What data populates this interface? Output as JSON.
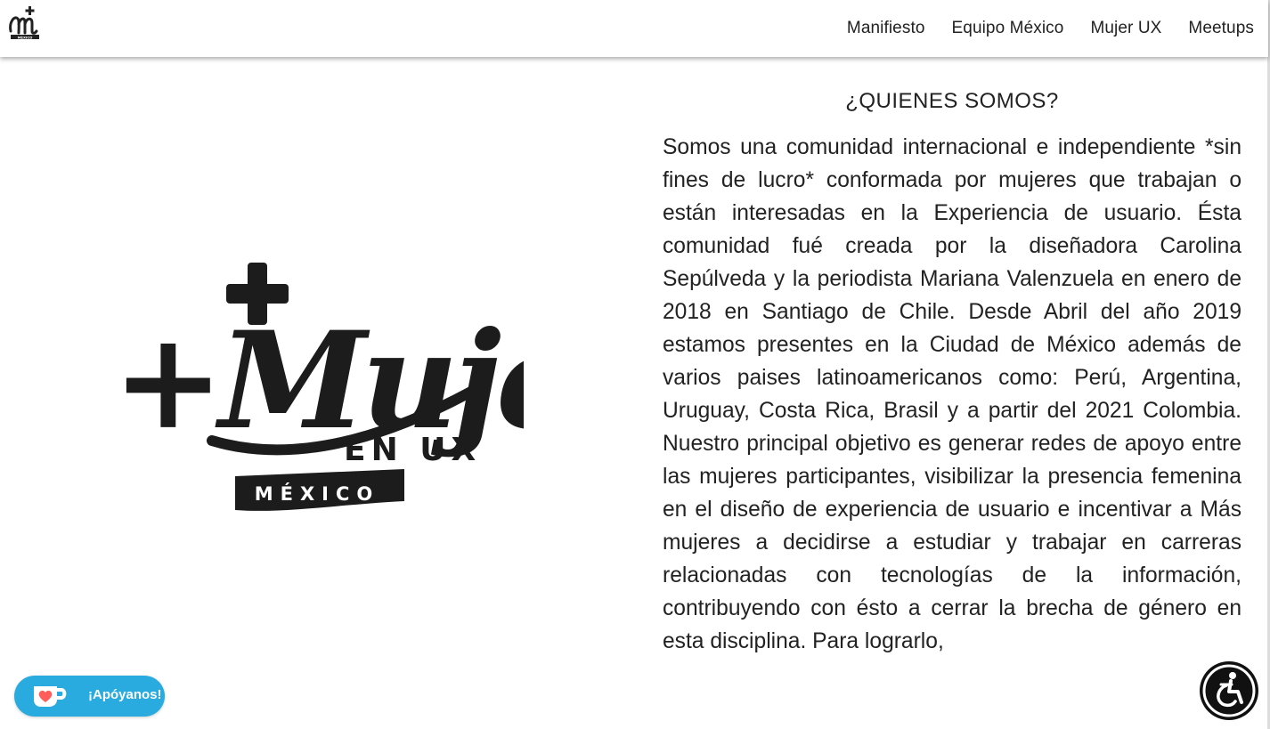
{
  "header": {
    "logo_alt": "+M México",
    "nav": [
      {
        "label": "Manifiesto"
      },
      {
        "label": "Equipo México"
      },
      {
        "label": "Mujer UX"
      },
      {
        "label": "Meetups"
      }
    ]
  },
  "hero": {
    "logo_text_main": "+Mujeres",
    "logo_text_sub": "EN UX",
    "logo_text_country": "MÉXICO"
  },
  "about": {
    "title": "¿QUIENES SOMOS?",
    "body": "Somos una comunidad internacional e independiente *sin fines de lucro* conformada por mujeres que trabajan o están interesadas en la Experiencia de usuario. Ésta comunidad fué creada por la diseñadora Carolina Sepúlveda y la periodista Mariana Valenzuela en enero de 2018 en Santiago de Chile. Desde Abril del año 2019 estamos presentes en la Ciudad de México además de varios paises latinoamericanos como: Perú, Argentina, Uruguay, Costa Rica, Brasil y a partir del 2021 Colombia. Nuestro principal objetivo es generar redes de apoyo entre las mujeres participantes, visibilizar la presencia femenina en el diseño de experiencia de usuario e incentivar a Más mujeres a decidirse a estudiar y trabajar en carreras relacionadas con tecnologías de la información, contribuyendo con ésto a cerrar la brecha de género en esta disciplina. Para lograrlo,"
  },
  "support": {
    "label": "¡Apóyanos!",
    "icon": "ko-fi-cup-icon"
  },
  "accessibility": {
    "icon": "accessibility-icon"
  },
  "colors": {
    "support_button": "#29abe0",
    "accessibility_button": "#111111",
    "text": "#222222"
  }
}
